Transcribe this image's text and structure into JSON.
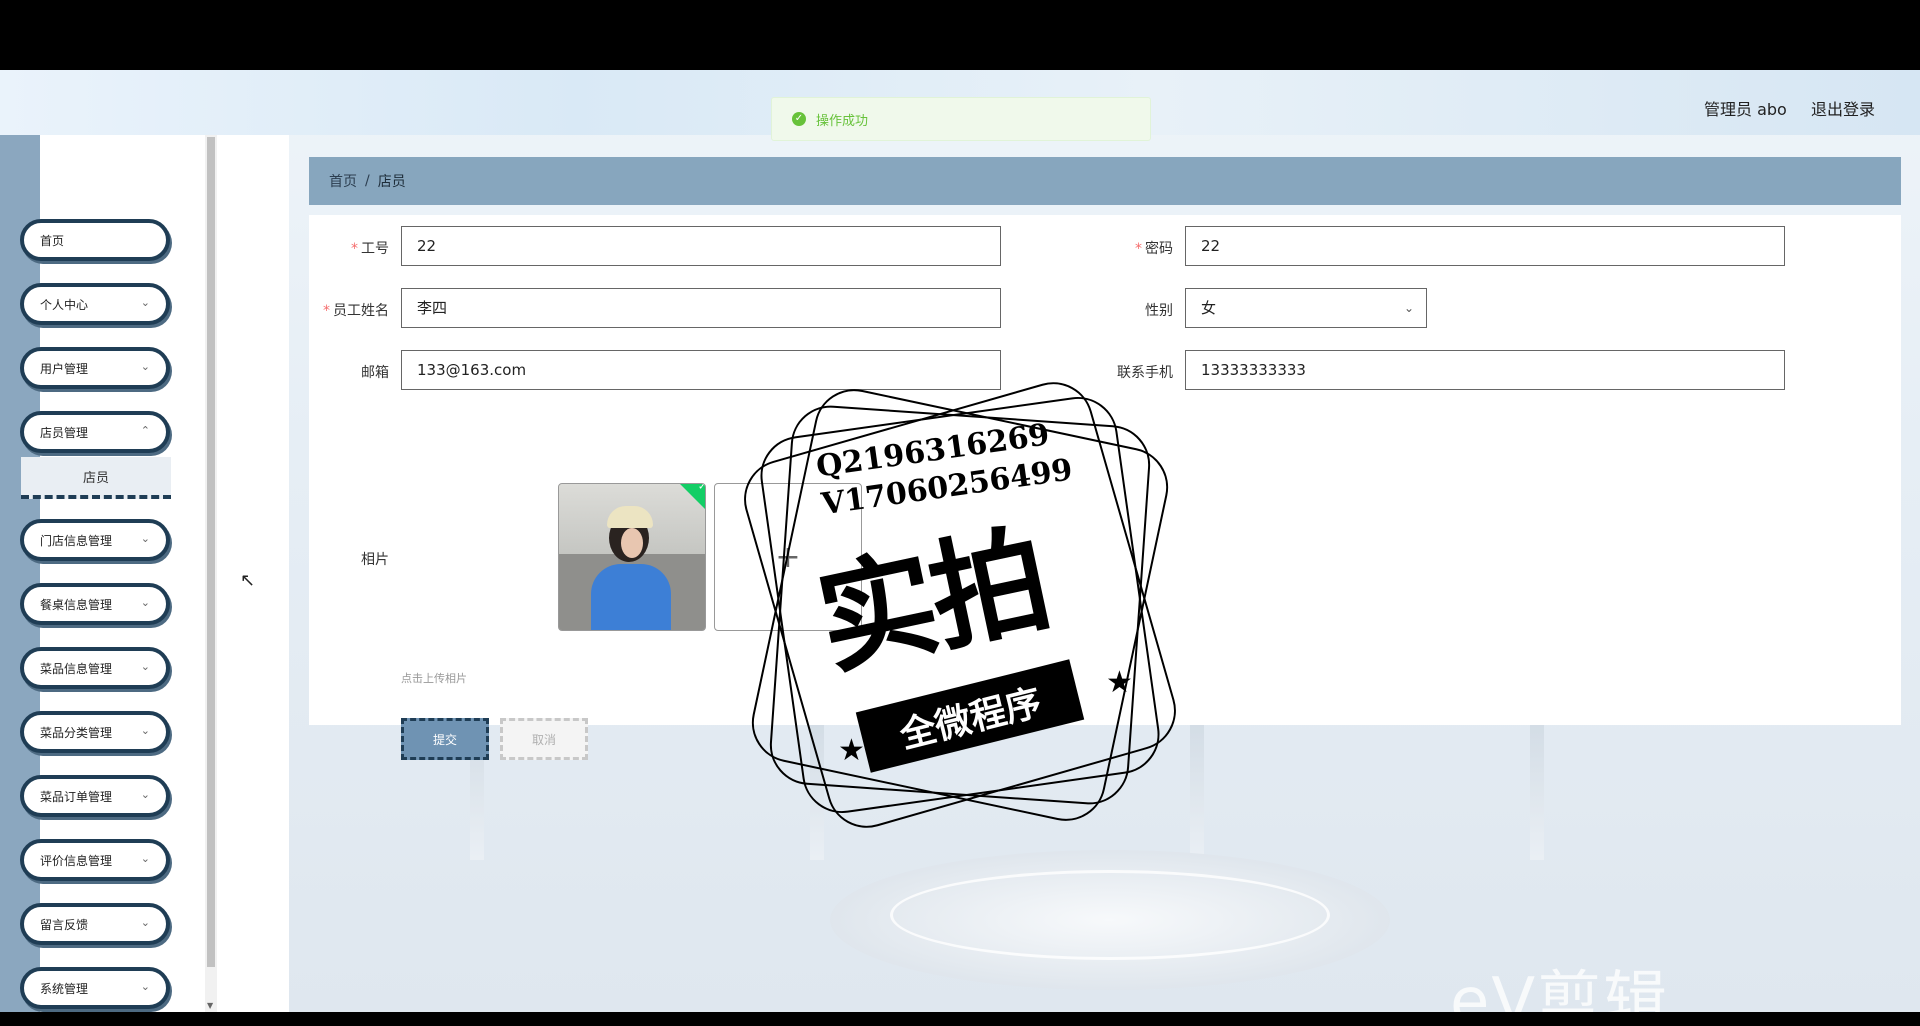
{
  "header": {
    "site_title": "",
    "user": "管理员 abo",
    "logout": "退出登录"
  },
  "toast": {
    "message": "操作成功"
  },
  "sidebar": {
    "items": [
      {
        "label": "首页",
        "has_children": false
      },
      {
        "label": "个人中心",
        "has_children": true
      },
      {
        "label": "用户管理",
        "has_children": true
      },
      {
        "label": "店员管理",
        "has_children": true
      },
      {
        "label": "门店信息管理",
        "has_children": true
      },
      {
        "label": "餐桌信息管理",
        "has_children": true
      },
      {
        "label": "菜品信息管理",
        "has_children": true
      },
      {
        "label": "菜品分类管理",
        "has_children": true
      },
      {
        "label": "菜品订单管理",
        "has_children": true
      },
      {
        "label": "评价信息管理",
        "has_children": true
      },
      {
        "label": "留言反馈",
        "has_children": true
      },
      {
        "label": "系统管理",
        "has_children": true
      }
    ],
    "active_sub": "店员"
  },
  "breadcrumb": {
    "home": "首页",
    "separator": "/",
    "current": "店员"
  },
  "form": {
    "job_no": {
      "label": "工号",
      "value": "22",
      "required": true
    },
    "password": {
      "label": "密码",
      "value": "22",
      "required": true
    },
    "name": {
      "label": "员工姓名",
      "value": "李四",
      "required": true
    },
    "gender": {
      "label": "性别",
      "value": "女"
    },
    "email": {
      "label": "邮箱",
      "value": "133@163.com"
    },
    "phone": {
      "label": "联系手机",
      "value": "13333333333"
    },
    "photo": {
      "label": "相片",
      "upload_tip": "点击上传相片"
    },
    "submit_label": "提交",
    "cancel_label": "取消"
  },
  "watermark": {
    "line1": "Q2196316269",
    "line2": "V17060256499",
    "big_text": "实拍",
    "banner_text": "全微程序",
    "ev_logo": "eV剪辑"
  },
  "colors": {
    "sidebar_rail": "#8ba7bf",
    "breadcrumb_bg": "#87a6be",
    "menu_border": "#1f3d55",
    "submit_bg": "#6f93b3",
    "toast_text": "#67c23a"
  }
}
